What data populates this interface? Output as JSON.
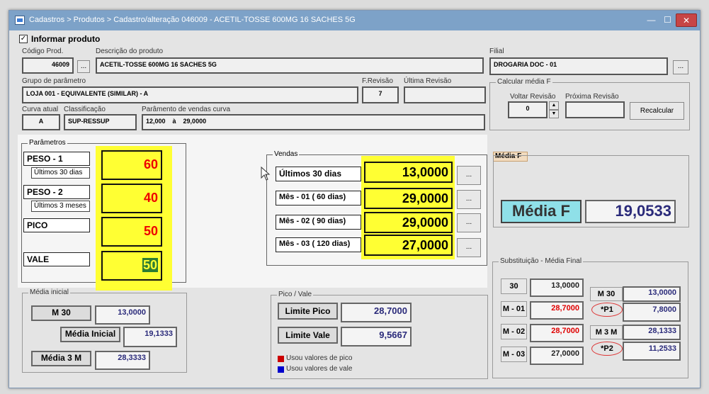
{
  "title": "Cadastros > Produtos > Cadastro/alteração  046009 - ACETIL-TOSSE 600MG 16 SACHES 5G",
  "informar": "Informar produto",
  "codigo": {
    "label": "Código Prod.",
    "value": "46009",
    "btn": "..."
  },
  "descricao": {
    "label": "Descrição do  produto",
    "value": "ACETIL-TOSSE 600MG 16 SACHES 5G"
  },
  "filial": {
    "label": "Filial",
    "value": "DROGARIA DOC - 01",
    "btn": "..."
  },
  "grupo": {
    "label": "Grupo de parâmetro",
    "value": "LOJA 001 - EQUIVALENTE (SIMILAR) - A"
  },
  "frevisao": {
    "label": "F.Revisão",
    "value": "7"
  },
  "ultima": {
    "label": "Última Revisão",
    "value": ""
  },
  "curva": {
    "label": "Curva atual",
    "value": "A"
  },
  "classificacao": {
    "label": "Classificação",
    "value": "SUP-RESSUP"
  },
  "parametro_curva": {
    "label": "Parâmento de vendas curva",
    "from": "12,000",
    "sep": "à",
    "to": "29,0000"
  },
  "calc": {
    "title": "Calcular média F",
    "voltar_label": "Voltar Revisão",
    "proxima_label": "Próxima Revisão",
    "voltar_value": "0",
    "spin_up": "▲",
    "spin_down": "▼",
    "recalcular": "Recalcular"
  },
  "parametros": {
    "title": "Parâmetros",
    "peso1": {
      "label": "PESO - 1",
      "sub": "Últimos 30 dias",
      "value": "60"
    },
    "peso2": {
      "label": "PESO - 2",
      "sub": "Últimos 3 meses",
      "value": "40"
    },
    "pico": {
      "label": "PICO",
      "value": "50"
    },
    "vale": {
      "label": "VALE",
      "value": "50"
    }
  },
  "vendas": {
    "title": "Vendas",
    "rows": [
      {
        "label": "Últimos 30 dias",
        "value": "13,0000",
        "btn": "..."
      },
      {
        "label": "Mês - 01 ( 60 dias)",
        "value": "29,0000",
        "btn": "..."
      },
      {
        "label": "Mês - 02 ( 90 dias)",
        "value": "29,0000",
        "btn": "..."
      },
      {
        "label": "Mês - 03 ( 120 dias)",
        "value": "27,0000",
        "btn": "..."
      }
    ]
  },
  "mediaF": {
    "tab": "Média F",
    "label": "Média F",
    "value": "19,0533"
  },
  "media_inicial": {
    "title": "Média inicial",
    "m30_label": "M 30",
    "m30_value": "13,0000",
    "mi_label": "Média Inicial",
    "mi_value": "19,1333",
    "m3m_label": "Média 3 M",
    "m3m_value": "28,3333"
  },
  "pico_vale": {
    "title": "Pico / Vale",
    "pico_label": "Limite Pico",
    "pico_value": "28,7000",
    "vale_label": "Limite Vale",
    "vale_value": "9,5667",
    "legend_pico": "Usou valores de pico",
    "legend_vale": "Usou valores de vale",
    "color_pico": "#cc0000",
    "color_vale": "#0000cc"
  },
  "subst": {
    "title": "Substituição - Média Final",
    "r30_label": "30",
    "r30_value": "13,0000",
    "m01_label": "M - 01",
    "m01_value": "28,7000",
    "m02_label": "M - 02",
    "m02_value": "28,7000",
    "m03_label": "M - 03",
    "m03_value": "27,0000",
    "m30_label": "M 30",
    "m30_value": "13,0000",
    "p1_label": "*P1",
    "p1_value": "7,8000",
    "m3m_label": "M 3 M",
    "m3m_value": "28,1333",
    "p2_label": "*P2",
    "p2_value": "11,2533"
  },
  "colors": {
    "highlight": "#ffff33",
    "value_red": "#e00000",
    "value_blue": "#2a2a7a"
  }
}
